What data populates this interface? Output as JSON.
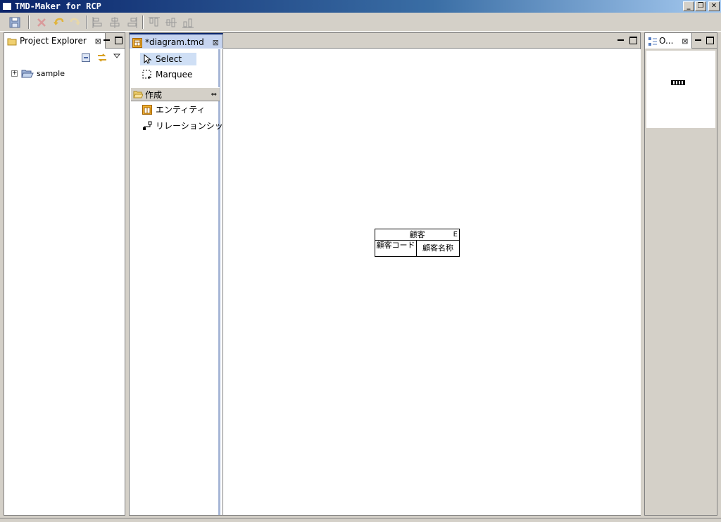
{
  "window": {
    "title": "TMD-Maker for RCP",
    "min_label": "_",
    "max_label": "❐",
    "close_label": "✕"
  },
  "project_explorer": {
    "tab_label": "Project Explorer",
    "tab_close": "⊠",
    "tree": [
      {
        "expander": "+",
        "label": "sample"
      }
    ]
  },
  "editor": {
    "tab_label": "*diagram.tmd",
    "tab_close": "⊠",
    "palette": {
      "select_label": "Select",
      "marquee_label": "Marquee",
      "drawer_label": "作成",
      "drawer_pin": "⇔",
      "entity_label": "エンティティ",
      "relationship_label": "リレーションシップ"
    },
    "entity": {
      "name": "顧客",
      "type": "E",
      "attributes": [
        "顧客コード",
        "顧客名称"
      ]
    }
  },
  "outline": {
    "tab_label": "O...",
    "tab_close": "⊠"
  }
}
